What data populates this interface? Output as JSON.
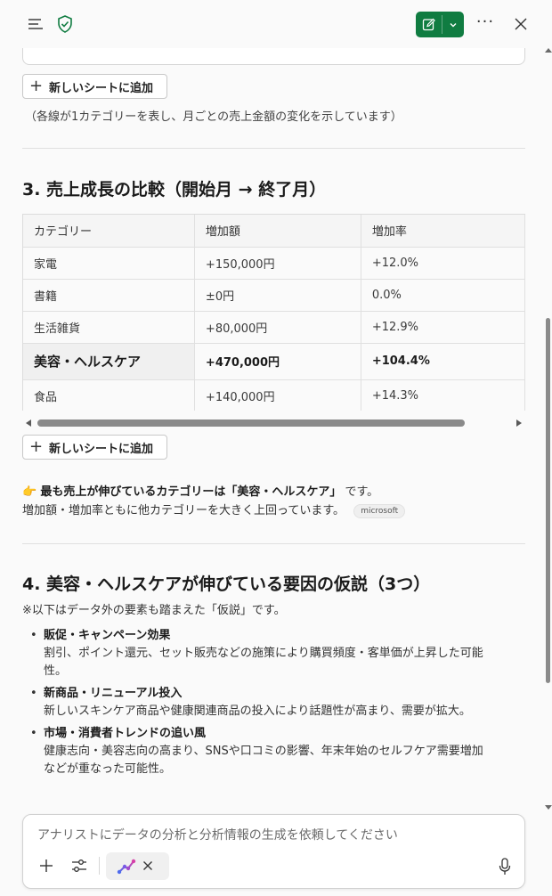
{
  "header": {
    "menu_icon": "hamburger-icon",
    "shield_icon": "shield-check-icon",
    "new_chat_icon": "edit-icon",
    "dropdown_icon": "chevron-down-icon",
    "more_label": "···",
    "close_icon": "close-icon",
    "accent_color": "#107c41"
  },
  "content": {
    "add_sheet_label": "新しいシートに追加",
    "chart_note": "（各線が1カテゴリーを表し、月ごとの売上金額の変化を示しています）",
    "section3_title": "3. 売上成長の比較（開始月 → 終了月）",
    "table": {
      "headers": [
        "カテゴリー",
        "増加額",
        "増加率"
      ],
      "rows": [
        [
          "家電",
          "+150,000円",
          "+12.0%"
        ],
        [
          "書籍",
          "±0円",
          "0.0%"
        ],
        [
          "生活雑貨",
          "+80,000円",
          "+12.9%"
        ],
        [
          "美容・ヘルスケア",
          "+470,000円",
          "+104.4%"
        ],
        [
          "食品",
          "+140,000円",
          "+14.3%"
        ]
      ]
    },
    "add_sheet_label_2": "新しいシートに追加",
    "highlight_emoji": "👉",
    "highlight_bold": "最も売上が伸びているカテゴリーは「美容・ヘルスケア」",
    "highlight_end": " です。",
    "highlight_line2": "増加額・増加率ともに他カテゴリーを大きく上回っています。",
    "source_badge": "microsoft",
    "section4_title": "4. 美容・ヘルスケアが伸びている要因の仮説（3つ）",
    "section4_note": "※以下はデータ外の要素も踏まえた「仮説」です。",
    "hypotheses": [
      {
        "title": "販促・キャンペーン効果",
        "line1": "割引、ポイント還元、セット販売などの施策により購買頻度・客単価が上昇した可能",
        "line2": "性。"
      },
      {
        "title": "新商品・リニューアル投入",
        "line1": "新しいスキンケア商品や健康関連商品の投入により話題性が高まり、需要が拡大。",
        "line2": ""
      },
      {
        "title": "市場・消費者トレンドの追い風",
        "line1": "健康志向・美容志向の高まり、SNSや口コミの影響、年末年始のセルフケア需要増加",
        "line2": "などが重なった可能性。"
      }
    ]
  },
  "composer": {
    "placeholder": "アナリストにデータの分析と分析情報の生成を依頼してください",
    "plus_icon": "plus-icon",
    "tools_icon": "sliders-icon",
    "agent_icon": "analyst-agent-icon",
    "remove_icon": "close-icon",
    "mic_icon": "microphone-icon"
  }
}
